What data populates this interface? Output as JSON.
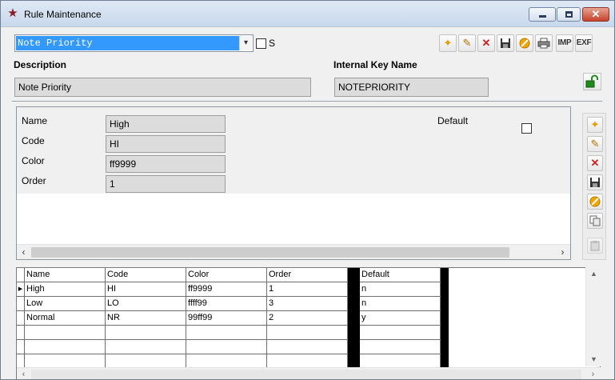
{
  "window": {
    "title": "Rule Maintenance",
    "min_label": "minimize",
    "max_label": "maximize",
    "close_label": "close"
  },
  "selector": {
    "value": "Note Priority",
    "s_label": "S"
  },
  "toolbar": {
    "imp_label": "IMP",
    "exf_label": "EXF",
    "icons": [
      "new-icon",
      "edit-icon",
      "delete-icon",
      "save-icon",
      "cancel-icon",
      "print-icon"
    ]
  },
  "header": {
    "description_label": "Description",
    "description_value": "Note Priority",
    "internal_key_label": "Internal Key Name",
    "internal_key_value": "NOTEPRIORITY"
  },
  "detail": {
    "name_label": "Name",
    "name_value": "High",
    "code_label": "Code",
    "code_value": "HI",
    "color_label": "Color",
    "color_value": "ff9999",
    "order_label": "Order",
    "order_value": "1",
    "default_label": "Default"
  },
  "grid": {
    "columns": [
      "Name",
      "Code",
      "Color",
      "Order",
      "",
      "Default"
    ],
    "rows": [
      [
        "High",
        "HI",
        "ff9999",
        "1",
        "",
        "n"
      ],
      [
        "Low",
        "LO",
        "ffff99",
        "3",
        "",
        "n"
      ],
      [
        "Normal",
        "NR",
        "99ff99",
        "2",
        "",
        "y"
      ],
      [
        "",
        "",
        "",
        "",
        "",
        ""
      ],
      [
        "",
        "",
        "",
        "",
        "",
        ""
      ],
      [
        "",
        "",
        "",
        "",
        "",
        ""
      ]
    ]
  },
  "colors": {
    "selection": "#3399ff",
    "field_bg": "#dcdcdc",
    "close_red": "#c7412b"
  }
}
